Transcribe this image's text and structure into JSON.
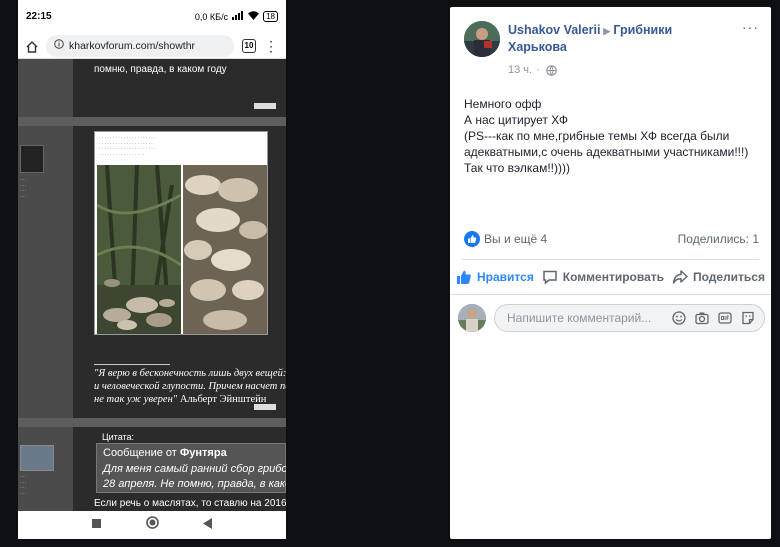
{
  "phone": {
    "status": {
      "time": "22:15",
      "speed": "0,0 КБ/с",
      "battery": "18"
    },
    "browser": {
      "url": "kharkovforum.com/showthr",
      "tab_count": "10"
    },
    "forum": {
      "top_text": "помню, правда, в каком году",
      "signature_line1": "\"Я верю в бесконечность лишь двух вещей: Вс",
      "signature_line2": "и человеческой глупости. Причем насчет пе",
      "signature_line3_italic": "не так уж уверен\"",
      "signature_line3_author": " Альберт Эйнштейн",
      "quote_label": "Цитата:",
      "quote_from_prefix": "Сообщение от ",
      "quote_from_author": "Фунтяра",
      "quote_line1": "Для меня самый ранний сбор грибов",
      "quote_line2": "28 апреля. Не помню, правда, в како",
      "reply_text": "Если речь о маслятах, то ставлю на 2016"
    }
  },
  "post": {
    "author": "Ushakov Valerii",
    "group": "Грибники Харькова",
    "time": "13 ч.",
    "more": "···",
    "body": [
      "Немного офф",
      "А нас цитирует ХФ",
      "(PS---как по мне,грибные темы ХФ всегда были адекватными,с очень адекватными участниками!!!)",
      "Так что вэлкам!!))))"
    ],
    "reactions": "Вы и ещё 4",
    "shares": "Поделились: 1",
    "actions": {
      "like": "Нравится",
      "comment": "Комментировать",
      "share": "Поделиться"
    },
    "comment_placeholder": "Напишите комментарий...",
    "colors": {
      "link": "#385898",
      "liked": "#2d88ff",
      "like_bubble": "#1877f2"
    }
  }
}
